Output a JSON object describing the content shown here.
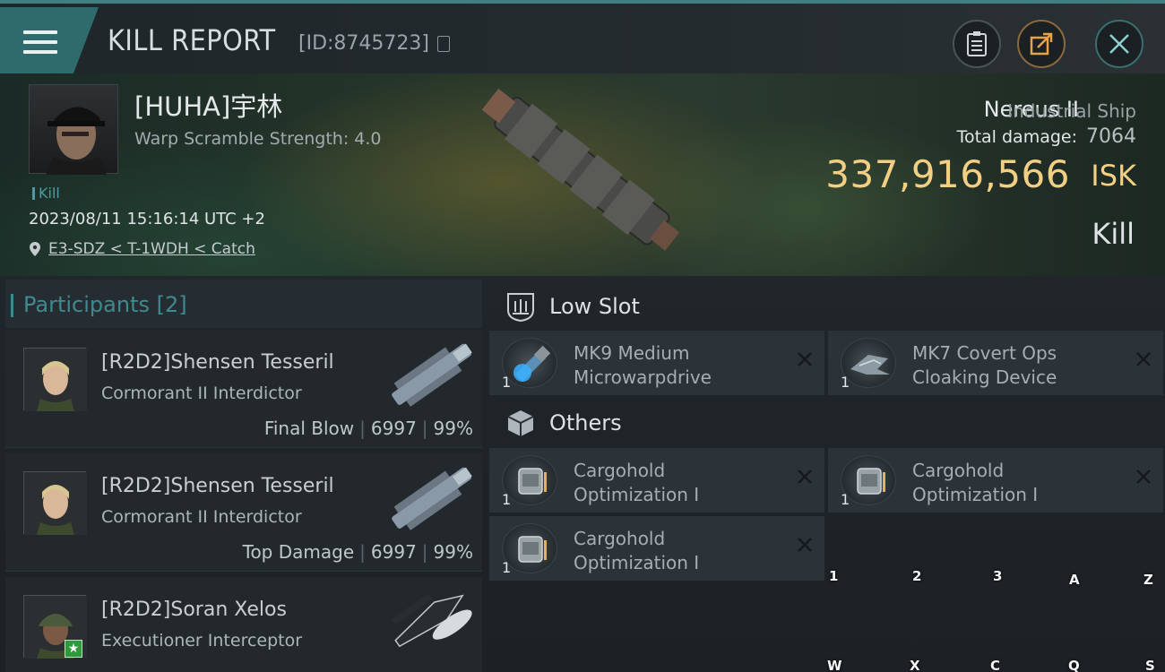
{
  "header": {
    "title": "KILL REPORT",
    "report_id": "[ID:8745723]",
    "colors": {
      "accent": "#3f7f80",
      "isk": "#f3cf84"
    }
  },
  "victim": {
    "name": "[HUHA]宇林",
    "warp_scramble": "Warp Scramble Strength: 4.0",
    "kill_tag": "Kill",
    "datetime": "2023/08/11 15:16:14 UTC +2",
    "location": "E3-SDZ < T-1WDH < Catch",
    "ship_name": "Nereus II",
    "ship_class": "Industrial Ship",
    "damage_label": "Total damage:",
    "damage_value": "7064",
    "isk_value": "337,916,566",
    "isk_unit": "ISK",
    "result": "Kill"
  },
  "participants": {
    "title": "Participants [2]",
    "items": [
      {
        "name": "[R2D2]Shensen Tesseril",
        "ship": "Cormorant II Interdictor",
        "role": "Final Blow",
        "damage": "6997",
        "percent": "99%"
      },
      {
        "name": "[R2D2]Shensen Tesseril",
        "ship": "Cormorant II Interdictor",
        "role": "Top Damage",
        "damage": "6997",
        "percent": "99%"
      },
      {
        "name": "[R2D2]Soran Xelos",
        "ship": "Executioner Interceptor"
      }
    ]
  },
  "slots": {
    "low": {
      "title": "Low Slot",
      "modules": [
        {
          "line1": "MK9 Medium",
          "line2": "Microwarpdrive",
          "qty": "1"
        },
        {
          "line1": "MK7 Covert Ops",
          "line2": "Cloaking Device",
          "qty": "1"
        }
      ]
    },
    "others": {
      "title": "Others",
      "modules": [
        {
          "line1": "Cargohold",
          "line2": "Optimization I",
          "qty": "1"
        },
        {
          "line1": "Cargohold",
          "line2": "Optimization I",
          "qty": "1"
        },
        {
          "line1": "Cargohold",
          "line2": "Optimization I",
          "qty": "1"
        }
      ]
    }
  },
  "keys": [
    "1",
    "2",
    "3",
    "A",
    "Z",
    "W",
    "X",
    "C",
    "Q",
    "S"
  ]
}
